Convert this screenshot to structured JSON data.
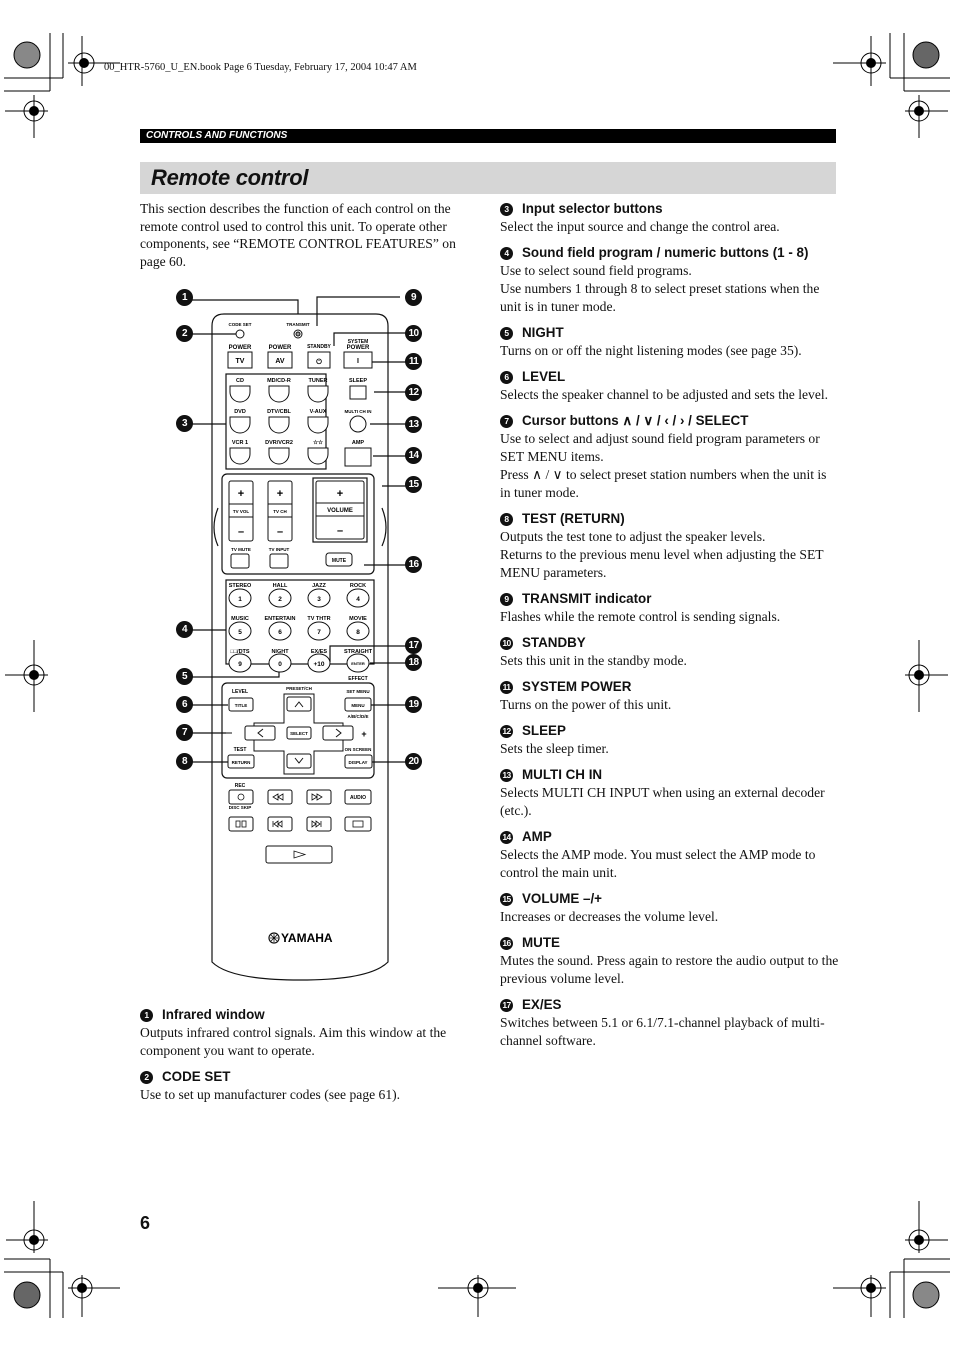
{
  "file_header": "00_HTR-5760_U_EN.book  Page 6  Tuesday, February 17, 2004  10:47 AM",
  "section": "CONTROLS AND FUNCTIONS",
  "title": "Remote control",
  "intro": "This section describes the function of each control on the remote control used to control this unit. To operate other components, see “REMOTE CONTROL FEATURES” on page 60.",
  "page_number": "6",
  "callouts": [
    "1",
    "2",
    "3",
    "4",
    "5",
    "6",
    "7",
    "8",
    "9",
    "10",
    "11",
    "12",
    "13",
    "14",
    "15",
    "16",
    "17",
    "18",
    "19",
    "20"
  ],
  "remote": {
    "code_set": "CODE SET",
    "transmit": "TRANSMIT",
    "power_tv_label": "POWER",
    "power_tv": "TV",
    "power_av_label": "POWER",
    "power_av": "AV",
    "standby": "STANDBY",
    "standby_symbol": "⏻",
    "system_power_top": "SYSTEM",
    "system_power": "POWER",
    "system_power_symbol": "I",
    "inputs": [
      "CD",
      "MD/CD-R",
      "TUNER",
      "DVD",
      "DTV/CBL",
      "V-AUX",
      "VCR 1",
      "DVR/VCR2",
      "☆☆"
    ],
    "sleep": "SLEEP",
    "multi_ch_in": "MULTI CH IN",
    "amp": "AMP",
    "tv_vol": "TV VOL",
    "tv_ch": "TV CH",
    "volume": "VOLUME",
    "plus": "+",
    "minus": "–",
    "tv_mute": "TV MUTE",
    "tv_input": "TV INPUT",
    "mute": "MUTE",
    "programs": [
      {
        "label": "STEREO",
        "num": "1"
      },
      {
        "label": "HALL",
        "num": "2"
      },
      {
        "label": "JAZZ",
        "num": "3"
      },
      {
        "label": "ROCK",
        "num": "4"
      },
      {
        "label": "MUSIC",
        "num": "5"
      },
      {
        "label": "ENTERTAIN",
        "num": "6"
      },
      {
        "label": "TV THTR",
        "num": "7"
      },
      {
        "label": "MOVIE",
        "num": "8"
      },
      {
        "label": "□□/DTS",
        "num": "9"
      },
      {
        "label": "NIGHT",
        "num": "0"
      },
      {
        "label": "EX/ES",
        "num": "+10"
      },
      {
        "label": "STRAIGHT",
        "num": "ENTER"
      }
    ],
    "effect": "EFFECT",
    "level": "LEVEL",
    "title_btn": "TITLE",
    "preset_ch": "PRESET/CH",
    "set_menu": "SET MENU",
    "menu": "MENU",
    "abcde": "A/B/C/D/E",
    "select": "SELECT",
    "test": "TEST",
    "return": "RETURN",
    "on_screen": "ON SCREEN",
    "display": "DISPLAY",
    "rec": "REC",
    "disc_skip": "DISC SKIP",
    "audio": "AUDIO",
    "brand": "YAMAHA"
  },
  "items_left": [
    {
      "num": "1",
      "title": "Infrared window",
      "body": [
        "Outputs infrared control signals. Aim this window at the component you want to operate."
      ]
    },
    {
      "num": "2",
      "title": "CODE SET",
      "body": [
        "Use to set up manufacturer codes (see page 61)."
      ]
    }
  ],
  "items_right": [
    {
      "num": "3",
      "title": "Input selector buttons",
      "body": [
        "Select the input source and change the control area."
      ]
    },
    {
      "num": "4",
      "title": "Sound field program / numeric buttons (1 - 8)",
      "body": [
        "Use to select sound field programs.",
        "Use numbers 1 through 8 to select preset stations when the unit is in tuner mode."
      ]
    },
    {
      "num": "5",
      "title": "NIGHT",
      "body": [
        "Turns on or off the night listening modes (see page 35)."
      ]
    },
    {
      "num": "6",
      "title": "LEVEL",
      "body": [
        "Selects the speaker channel to be adjusted and sets the level."
      ]
    },
    {
      "num": "7",
      "title": "Cursor buttons ∧ / ∨  / ‹ / › / SELECT",
      "body": [
        "Use to select and adjust sound field program parameters or SET MENU items.",
        "Press ∧ / ∨ to select preset station numbers when the unit is in tuner mode."
      ]
    },
    {
      "num": "8",
      "title": "TEST (RETURN)",
      "body": [
        "Outputs the test tone to adjust the speaker levels.",
        "Returns to the previous menu level when adjusting the SET MENU parameters."
      ]
    },
    {
      "num": "9",
      "title": "TRANSMIT indicator",
      "body": [
        "Flashes while the remote control is sending signals."
      ]
    },
    {
      "num": "10",
      "title": "STANDBY",
      "body": [
        "Sets this unit in the standby mode."
      ]
    },
    {
      "num": "11",
      "title": "SYSTEM POWER",
      "body": [
        "Turns on the power of this unit."
      ]
    },
    {
      "num": "12",
      "title": "SLEEP",
      "body": [
        "Sets the sleep timer."
      ]
    },
    {
      "num": "13",
      "title": "MULTI CH IN",
      "body": [
        "Selects MULTI CH INPUT when using an external decoder (etc.)."
      ]
    },
    {
      "num": "14",
      "title": "AMP",
      "body": [
        "Selects the AMP mode. You must select the AMP mode to control the main unit."
      ]
    },
    {
      "num": "15",
      "title": "VOLUME –/+",
      "body": [
        "Increases or decreases the volume level."
      ]
    },
    {
      "num": "16",
      "title": "MUTE",
      "body": [
        "Mutes the sound. Press again to restore the audio output to the previous volume level."
      ]
    },
    {
      "num": "17",
      "title": "EX/ES",
      "body": [
        "Switches between 5.1 or 6.1/7.1-channel playback of multi-channel software."
      ]
    }
  ]
}
